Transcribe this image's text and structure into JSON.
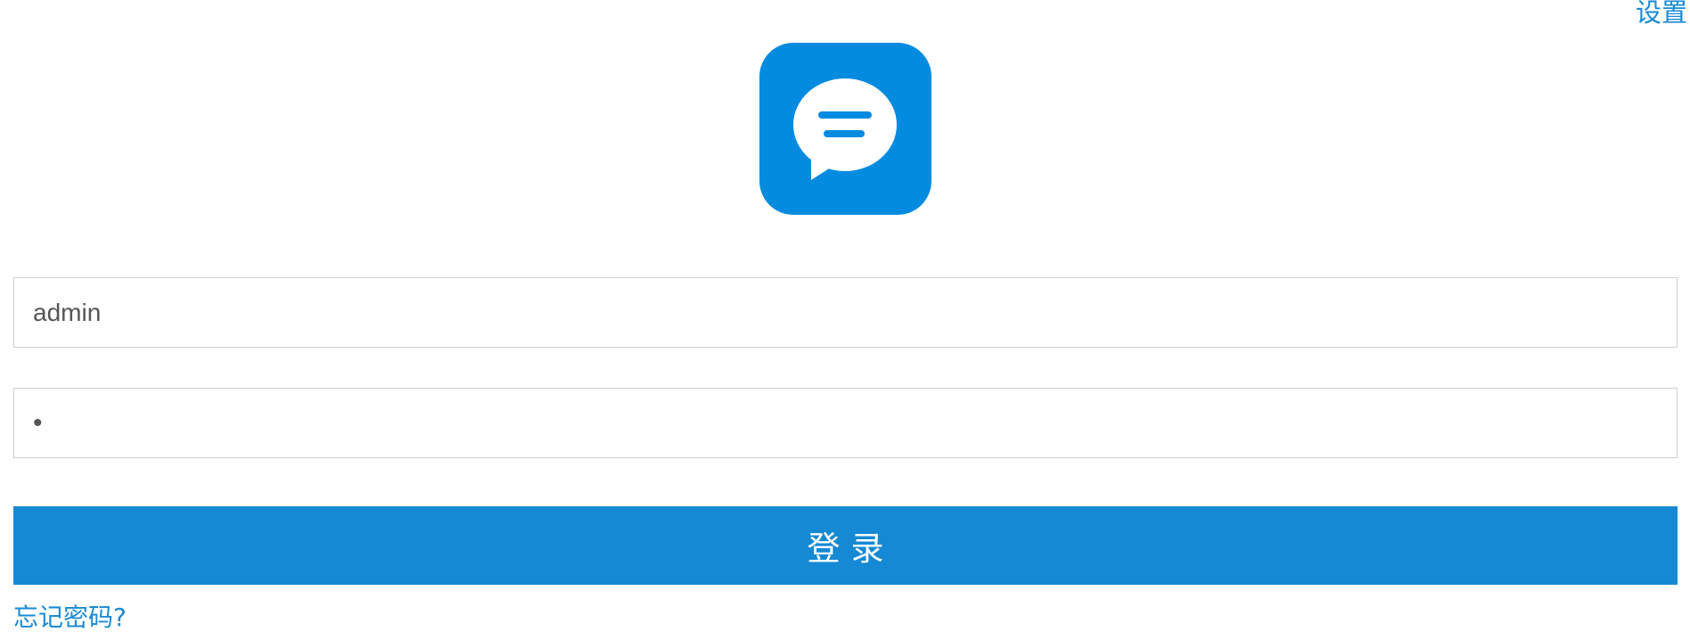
{
  "header": {
    "settings_label": "设置"
  },
  "logo": {
    "icon": "chat-bubble-icon",
    "color": "#038be0"
  },
  "form": {
    "username_value": "admin",
    "password_value": "•",
    "login_label": "登录",
    "forgot_label": "忘记密码?"
  },
  "colors": {
    "accent": "#1689d4",
    "link": "#1a8ad4",
    "border": "#cfcfcf"
  }
}
